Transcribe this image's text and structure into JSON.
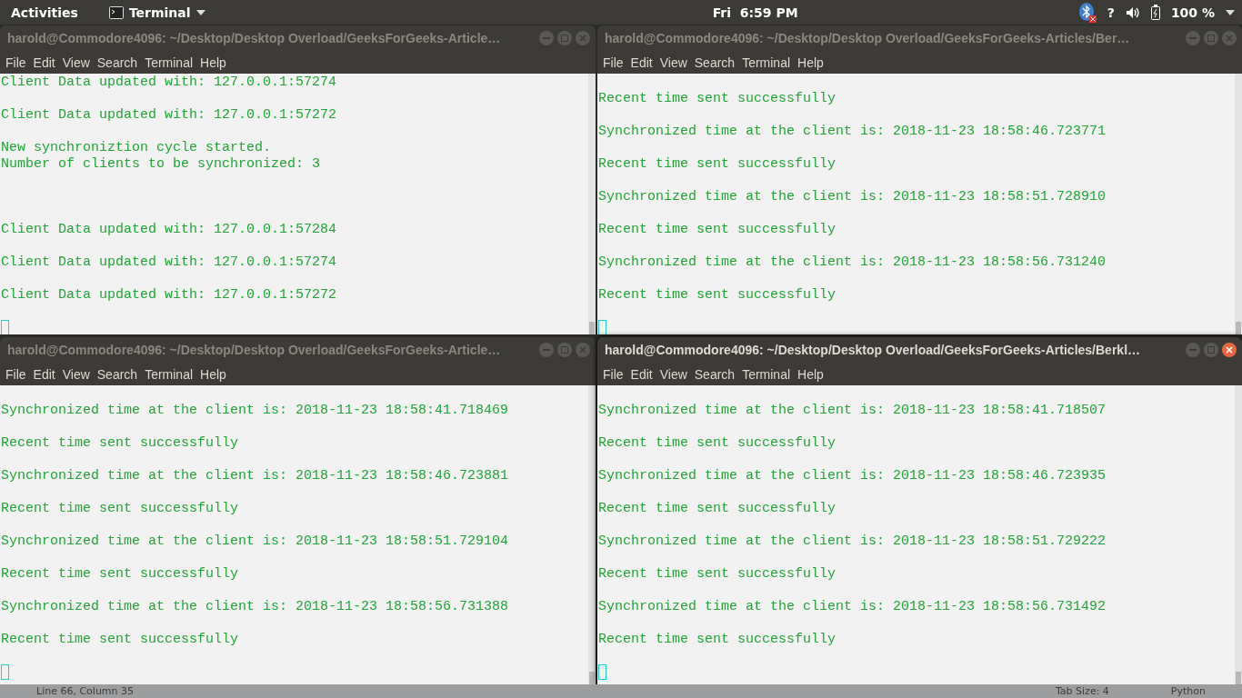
{
  "top_bar": {
    "activities": "Activities",
    "app_menu": "Terminal",
    "clock": "Fri  6:59 PM",
    "status_text": "?",
    "battery": "100 %"
  },
  "windows": [
    {
      "title": "harold@Commodore4096: ~/Desktop/Desktop Overload/GeeksForGeeks-Article…",
      "focused": false,
      "menu": [
        "File",
        "Edit",
        "View",
        "Search",
        "Terminal",
        "Help"
      ],
      "blocks": [
        {
          "kind": "output",
          "lines": [
            "Client Data updated with: 127.0.0.1:57274"
          ]
        },
        {
          "kind": "output",
          "lines": [
            "Client Data updated with: 127.0.0.1:57272"
          ]
        },
        {
          "kind": "output",
          "lines": [
            "New synchroniztion cycle started.",
            "Number of clients to be synchronized: 3"
          ]
        },
        {
          "kind": "blank"
        },
        {
          "kind": "blank"
        },
        {
          "kind": "output",
          "lines": [
            "Client Data updated with: 127.0.0.1:57284"
          ]
        },
        {
          "kind": "output",
          "lines": [
            "Client Data updated with: 127.0.0.1:57274"
          ]
        },
        {
          "kind": "output",
          "lines": [
            "Client Data updated with: 127.0.0.1:57272"
          ]
        }
      ]
    },
    {
      "title": "harold@Commodore4096: ~/Desktop/Desktop Overload/GeeksForGeeks-Articles/Ber…",
      "focused": false,
      "menu": [
        "File",
        "Edit",
        "View",
        "Search",
        "Terminal",
        "Help"
      ],
      "blocks": [
        {
          "kind": "blank"
        },
        {
          "kind": "output",
          "lines": [
            "Recent time sent successfully"
          ]
        },
        {
          "kind": "output",
          "lines": [
            "Synchronized time at the client is: 2018-11-23 18:58:46.723771"
          ]
        },
        {
          "kind": "output",
          "lines": [
            "Recent time sent successfully"
          ]
        },
        {
          "kind": "output",
          "lines": [
            "Synchronized time at the client is: 2018-11-23 18:58:51.728910"
          ]
        },
        {
          "kind": "output",
          "lines": [
            "Recent time sent successfully"
          ]
        },
        {
          "kind": "output",
          "lines": [
            "Synchronized time at the client is: 2018-11-23 18:58:56.731240"
          ]
        },
        {
          "kind": "output",
          "lines": [
            "Recent time sent successfully"
          ]
        }
      ]
    },
    {
      "title": "harold@Commodore4096: ~/Desktop/Desktop Overload/GeeksForGeeks-Article…",
      "focused": false,
      "menu": [
        "File",
        "Edit",
        "View",
        "Search",
        "Terminal",
        "Help"
      ],
      "blocks": [
        {
          "kind": "blank"
        },
        {
          "kind": "output",
          "lines": [
            "Synchronized time at the client is: 2018-11-23 18:58:41.718469"
          ]
        },
        {
          "kind": "output",
          "lines": [
            "Recent time sent successfully"
          ]
        },
        {
          "kind": "output",
          "lines": [
            "Synchronized time at the client is: 2018-11-23 18:58:46.723881"
          ]
        },
        {
          "kind": "output",
          "lines": [
            "Recent time sent successfully"
          ]
        },
        {
          "kind": "output",
          "lines": [
            "Synchronized time at the client is: 2018-11-23 18:58:51.729104"
          ]
        },
        {
          "kind": "output",
          "lines": [
            "Recent time sent successfully"
          ]
        },
        {
          "kind": "output",
          "lines": [
            "Synchronized time at the client is: 2018-11-23 18:58:56.731388"
          ]
        },
        {
          "kind": "output",
          "lines": [
            "Recent time sent successfully"
          ]
        }
      ]
    },
    {
      "title": "harold@Commodore4096: ~/Desktop/Desktop Overload/GeeksForGeeks-Articles/Berkl…",
      "focused": true,
      "menu": [
        "File",
        "Edit",
        "View",
        "Search",
        "Terminal",
        "Help"
      ],
      "blocks": [
        {
          "kind": "blank"
        },
        {
          "kind": "output",
          "lines": [
            "Synchronized time at the client is: 2018-11-23 18:58:41.718507"
          ]
        },
        {
          "kind": "output",
          "lines": [
            "Recent time sent successfully"
          ]
        },
        {
          "kind": "output",
          "lines": [
            "Synchronized time at the client is: 2018-11-23 18:58:46.723935"
          ]
        },
        {
          "kind": "output",
          "lines": [
            "Recent time sent successfully"
          ]
        },
        {
          "kind": "output",
          "lines": [
            "Synchronized time at the client is: 2018-11-23 18:58:51.729222"
          ]
        },
        {
          "kind": "output",
          "lines": [
            "Recent time sent successfully"
          ]
        },
        {
          "kind": "output",
          "lines": [
            "Synchronized time at the client is: 2018-11-23 18:58:56.731492"
          ]
        },
        {
          "kind": "output",
          "lines": [
            "Recent time sent successfully"
          ]
        }
      ]
    }
  ],
  "editor_status_bar": {
    "position": "Line 66, Column 35",
    "tab_size": "Tab Size: 4",
    "language": "Python"
  }
}
